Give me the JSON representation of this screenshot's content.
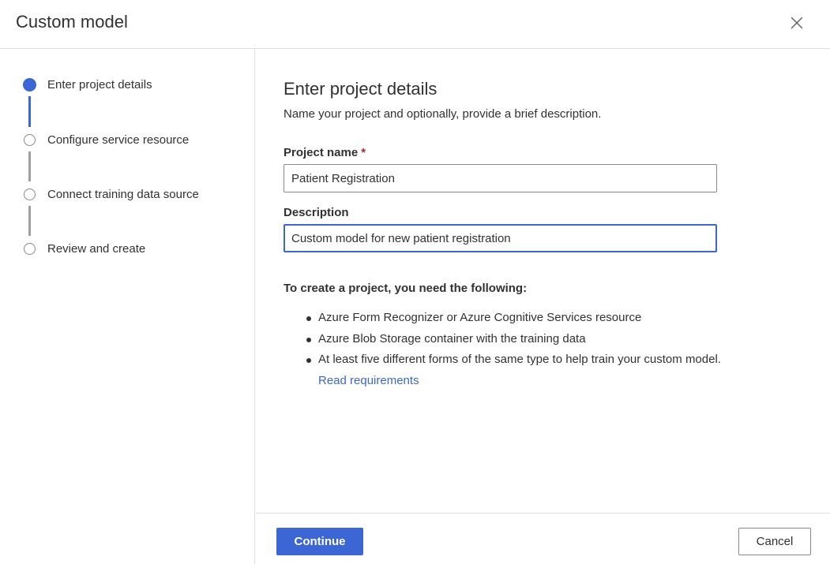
{
  "dialog": {
    "title": "Custom model",
    "close_icon": "close-icon"
  },
  "steps": [
    {
      "label": "Enter project details",
      "state": "active"
    },
    {
      "label": "Configure service resource",
      "state": "pending"
    },
    {
      "label": "Connect training data source",
      "state": "pending"
    },
    {
      "label": "Review and create",
      "state": "pending"
    }
  ],
  "main": {
    "title": "Enter project details",
    "subtitle": "Name your project and optionally, provide a brief description.",
    "project_name": {
      "label": "Project name",
      "required_marker": "*",
      "value": "Patient Registration"
    },
    "description": {
      "label": "Description",
      "value": "Custom model for new patient registration"
    },
    "requirements": {
      "title": "To create a project, you need the following:",
      "items": [
        "Azure Form Recognizer or Azure Cognitive Services resource",
        "Azure Blob Storage container with the training data",
        "At least five different forms of the same type to help train your custom model."
      ],
      "link_text": "Read requirements"
    }
  },
  "footer": {
    "continue_label": "Continue",
    "cancel_label": "Cancel"
  },
  "colors": {
    "accent": "#3b66d3",
    "border": "#8a8886",
    "divider": "#e1dfdd",
    "text": "#323130",
    "required": "#a4262c"
  }
}
